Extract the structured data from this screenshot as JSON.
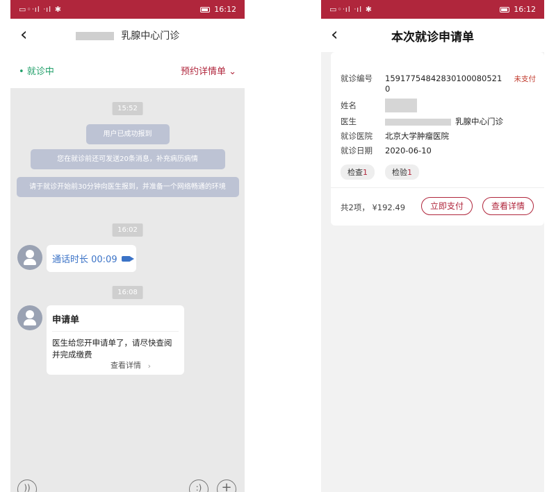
{
  "status_bar": {
    "signal": "▭◦ᐧıl ᐧıl ✱",
    "time": "16:12"
  },
  "left": {
    "title": "乳腺中心门诊",
    "status": "就诊中",
    "detail_label": "预约详情单",
    "chat": {
      "time1": "15:52",
      "msg_checkin": "用户已成功报到",
      "msg_limit": "您在就诊前还可发送20条消息，补充病历病情",
      "msg_prepare": "请于就诊开始前30分钟向医生报到，并准备一个网络畅通的环境",
      "time2": "16:02",
      "call": "通话时长 00:09",
      "time3": "16:08",
      "form_title": "申请单",
      "form_text": "医生给您开申请单了，请尽快查阅并完成缴费",
      "form_link": "查看详情"
    }
  },
  "right": {
    "title": "本次就诊申请单",
    "card": {
      "visit_no_label": "就诊编号",
      "visit_no": "15917754842830100080521",
      "visit_no_tail": "0",
      "unpaid": "未支付",
      "name_label": "姓名",
      "doctor_label": "医生",
      "doctor_value": "乳腺中心门诊",
      "hospital_label": "就诊医院",
      "hospital_value": "北京大学肿瘤医院",
      "date_label": "就诊日期",
      "date_value": "2020-06-10",
      "tag_check": "检查",
      "tag_check_count": "1",
      "tag_lab": "检验",
      "tag_lab_count": "1",
      "total": "共2项，  ¥192.49",
      "pay_label": "立即支付",
      "details_label": "查看详情"
    }
  },
  "colors": {
    "brand": "#b0263c",
    "status_green": "#23a06b",
    "link_blue": "#3b73c7"
  },
  "icons": [
    "back-icon",
    "chevron-down-icon",
    "avatar-icon",
    "video-icon",
    "voice-icon",
    "emoji-icon",
    "plus-icon"
  ]
}
